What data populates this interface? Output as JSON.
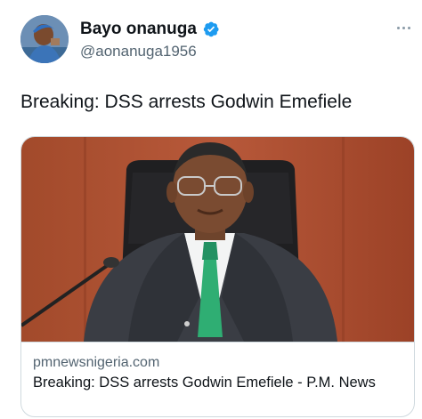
{
  "author": {
    "name": "Bayo onanuga",
    "handle": "@aonanuga1956",
    "verified": true,
    "avatar_icon": "profile-photo"
  },
  "menu": {
    "icon": "more-icon"
  },
  "tweet": {
    "text": "Breaking: DSS arrests Godwin Emefiele"
  },
  "card": {
    "domain": "pmnewsnigeria.com",
    "title": "Breaking: DSS arrests Godwin Emefiele - P.M. News",
    "image_icon": "news-photo"
  },
  "colors": {
    "verified_badge": "#1d9bf0",
    "secondary_text": "#536471",
    "border": "#cfd9de"
  }
}
